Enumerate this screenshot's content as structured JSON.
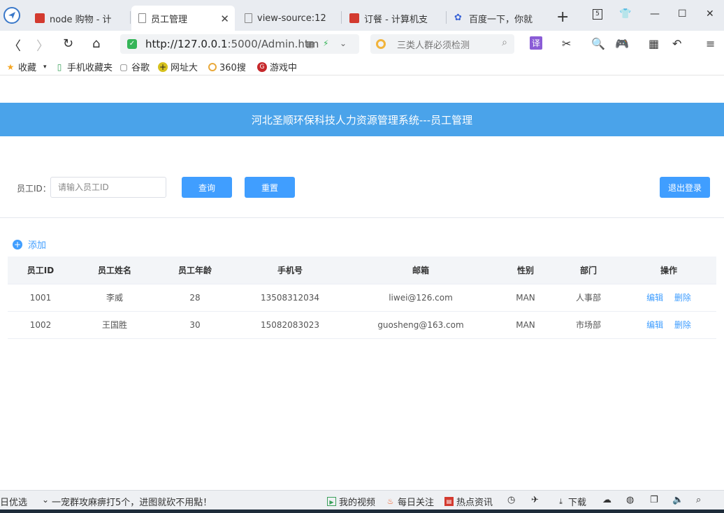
{
  "browser": {
    "tabs": [
      {
        "label": "node 购物 - 计",
        "icon_color": "#d33a2f"
      },
      {
        "label": "员工管理",
        "icon_color": "#888888"
      },
      {
        "label": "view-source:12",
        "icon_color": "#888888"
      },
      {
        "label": "订餐 - 计算机支",
        "icon_color": "#d33a2f"
      },
      {
        "label": "百度一下，你就",
        "icon_color": "#3a63d6"
      }
    ],
    "address": {
      "host": "http://127.0.0.1",
      "rest": ":5000/Admin.htm"
    },
    "search_placeholder": "三类人群必须检测",
    "translate_label": "译",
    "tab_count": "5"
  },
  "bookmarks": [
    {
      "label": "收藏",
      "icon": "star-icon"
    },
    {
      "label": "手机收藏夹",
      "icon": "phone-icon"
    },
    {
      "label": "谷歌",
      "icon": "page-icon"
    },
    {
      "label": "网址大",
      "icon": "plus-circle-icon"
    },
    {
      "label": "360搜",
      "icon": "360-icon"
    },
    {
      "label": "游戏中",
      "icon": "game-icon"
    }
  ],
  "page": {
    "banner_title": "河北圣顺环保科技人力资源管理系统---员工管理",
    "filter": {
      "label": "员工ID：",
      "placeholder": "请输入员工ID",
      "query_button": "查询",
      "reset_button": "重置",
      "logout_button": "退出登录"
    },
    "add_label": "添加",
    "table": {
      "columns": [
        "员工ID",
        "员工姓名",
        "员工年龄",
        "手机号",
        "邮箱",
        "性别",
        "部门",
        "操作"
      ],
      "rows": [
        {
          "id": "1001",
          "name": "李威",
          "age": "28",
          "phone": "13508312034",
          "email": "liwei@126.com",
          "gender": "MAN",
          "dept": "人事部"
        },
        {
          "id": "1002",
          "name": "王国胜",
          "age": "30",
          "phone": "15082083023",
          "email": "guosheng@163.com",
          "gender": "MAN",
          "dept": "市场部"
        }
      ],
      "edit_label": "编辑",
      "delete_label": "删除"
    }
  },
  "statusbar": {
    "left_text": "日优选",
    "news_text": "一宠群攻麻痹打5个，进图就砍不用點！",
    "items": [
      "我的视频",
      "每日关注",
      "热点资讯",
      "下载"
    ]
  },
  "colors": {
    "banner": "#4aa3ea",
    "button": "#409eff",
    "link": "#409eff"
  }
}
